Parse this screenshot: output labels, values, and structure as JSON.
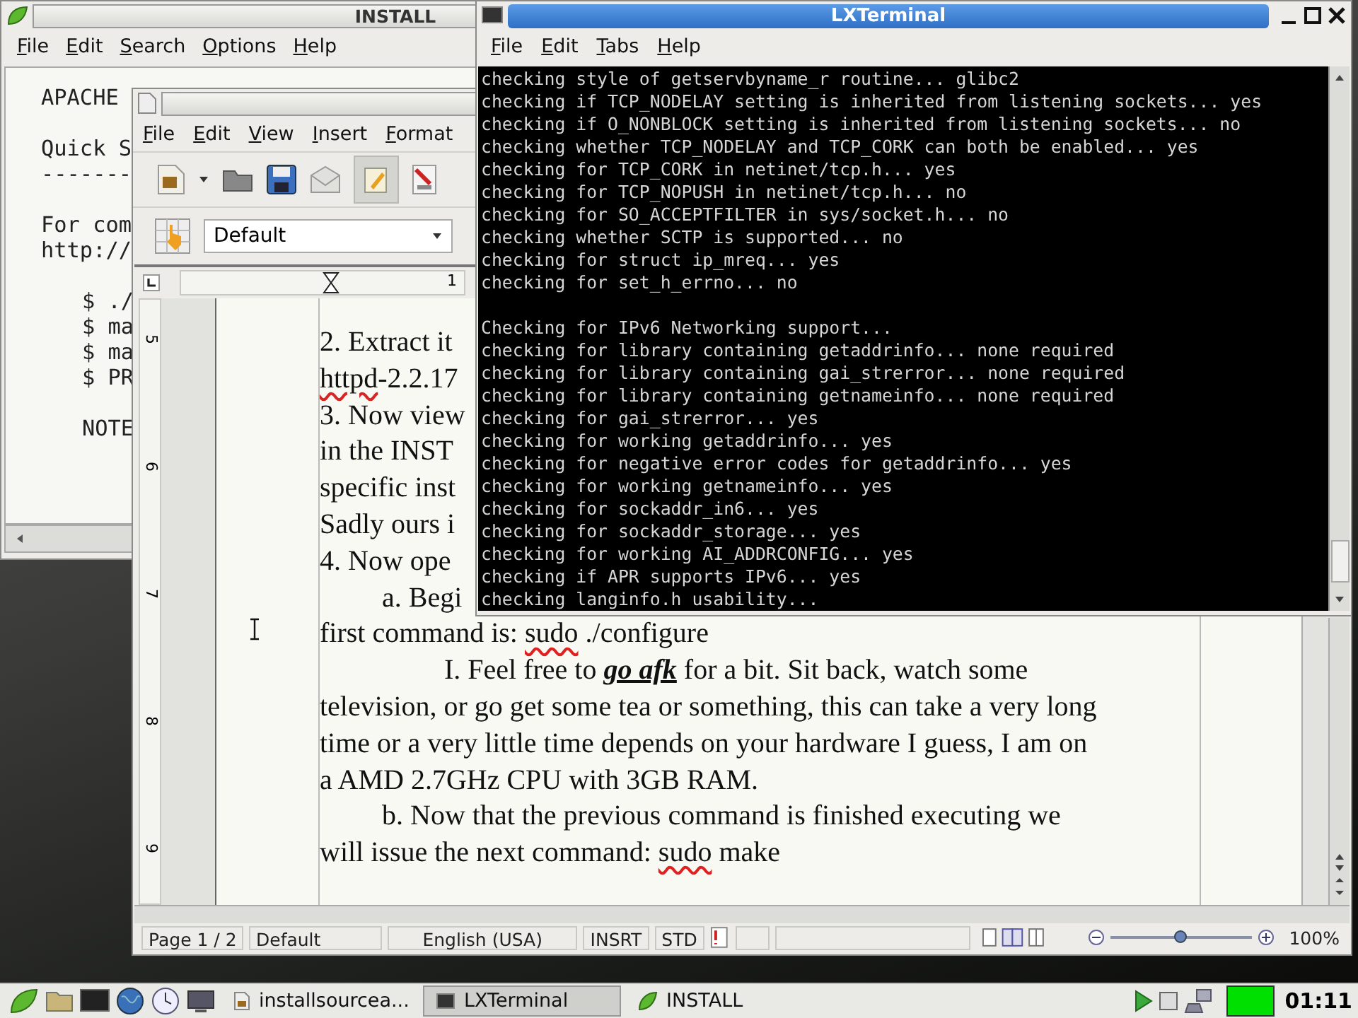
{
  "install_window": {
    "title": "INSTALL",
    "menu": [
      "File",
      "Edit",
      "Search",
      "Options",
      "Help"
    ],
    "blocks": [
      {
        "indented": false,
        "lines": [
          "APACHE"
        ]
      },
      {
        "indented": false,
        "lines": [
          "Quick S",
          "-------"
        ]
      },
      {
        "indented": false,
        "lines": [
          "For com",
          "http://"
        ]
      },
      {
        "indented": true,
        "lines": [
          "$ ./",
          "$ ma",
          "$ ma",
          "$ PR"
        ]
      },
      {
        "indented": true,
        "lines": [
          "NOTE"
        ]
      }
    ]
  },
  "writer_window": {
    "menu": [
      "File",
      "Edit",
      "View",
      "Insert",
      "Format"
    ],
    "paragraph_style": "Default",
    "horizontal_ruler_marks": [
      "1"
    ],
    "vertical_ruler_marks": [
      "5",
      "6",
      "7",
      "8",
      "9"
    ],
    "lines": [
      {
        "kind": "body",
        "parts": [
          {
            "text": "2. Extract it",
            "kind": "plain"
          }
        ]
      },
      {
        "kind": "body",
        "parts": [
          {
            "text": "httpd",
            "kind": "misspelled"
          },
          {
            "text": "-2.2.17",
            "kind": "plain"
          }
        ]
      },
      {
        "kind": "body",
        "parts": [
          {
            "text": "3. Now view",
            "kind": "plain"
          }
        ]
      },
      {
        "kind": "body",
        "parts": [
          {
            "text": "in the INST",
            "kind": "plain"
          }
        ]
      },
      {
        "kind": "body",
        "parts": [
          {
            "text": "specific inst",
            "kind": "plain"
          }
        ]
      },
      {
        "kind": "body",
        "parts": [
          {
            "text": "Sadly ours i",
            "kind": "plain"
          }
        ]
      },
      {
        "kind": "body",
        "parts": [
          {
            "text": "4. Now ope",
            "kind": "plain"
          }
        ]
      },
      {
        "kind": "sub",
        "parts": [
          {
            "text": "a. Begi",
            "kind": "plain"
          }
        ]
      },
      {
        "kind": "body",
        "parts": [
          {
            "text": "first command is: ",
            "kind": "plain"
          },
          {
            "text": "sudo",
            "kind": "misspelled"
          },
          {
            "text": " ./configure",
            "kind": "plain"
          }
        ]
      },
      {
        "kind": "subsub",
        "parts": [
          {
            "text": "I. Feel free to ",
            "kind": "plain"
          },
          {
            "text": "go afk",
            "kind": "emphasis"
          },
          {
            "text": " for a bit. Sit back, watch some",
            "kind": "plain"
          }
        ]
      },
      {
        "kind": "body",
        "parts": [
          {
            "text": "television, or go get some tea or something, this can take a very long",
            "kind": "plain"
          }
        ]
      },
      {
        "kind": "body",
        "parts": [
          {
            "text": "time or a very little time depends on your hardware I guess, I am on",
            "kind": "plain"
          }
        ]
      },
      {
        "kind": "body",
        "parts": [
          {
            "text": "a AMD 2.7GHz CPU with 3GB RAM.",
            "kind": "plain"
          }
        ]
      },
      {
        "kind": "sub",
        "parts": [
          {
            "text": "b. Now that the previous command is finished executing we",
            "kind": "plain"
          }
        ]
      },
      {
        "kind": "body",
        "parts": [
          {
            "text": "will issue the next command: ",
            "kind": "plain"
          },
          {
            "text": "sudo",
            "kind": "misspelled"
          },
          {
            "text": " make",
            "kind": "plain"
          }
        ]
      }
    ],
    "status_bar": {
      "page": "Page 1 / 2",
      "page_style": "Default",
      "language": "English (USA)",
      "insert_mode": "INSRT",
      "selection_mode": "STD",
      "zoom": {
        "level": 0.5
      },
      "zoom_reading": "100%"
    }
  },
  "terminal_window": {
    "title": "LXTerminal",
    "menu": [
      "File",
      "Edit",
      "Tabs",
      "Help"
    ],
    "blocks": [
      [
        "checking style of getservbyname_r routine... glibc2",
        "checking if TCP_NODELAY setting is inherited from listening sockets... yes",
        "checking if O_NONBLOCK setting is inherited from listening sockets... no",
        "checking whether TCP_NODELAY and TCP_CORK can both be enabled... yes",
        "checking for TCP_CORK in netinet/tcp.h... yes",
        "checking for TCP_NOPUSH in netinet/tcp.h... no",
        "checking for SO_ACCEPTFILTER in sys/socket.h... no",
        "checking whether SCTP is supported... no",
        "checking for struct ip_mreq... yes",
        "checking for set_h_errno... no"
      ],
      [
        "Checking for IPv6 Networking support...",
        "checking for library containing getaddrinfo... none required",
        "checking for library containing gai_strerror... none required",
        "checking for library containing getnameinfo... none required",
        "checking for gai_strerror... yes",
        "checking for working getaddrinfo... yes",
        "checking for negative error codes for getaddrinfo... yes",
        "checking for working getnameinfo... yes",
        "checking for sockaddr_in6... yes",
        "checking for sockaddr_storage... yes",
        "checking for working AI_ADDRCONFIG... yes",
        "checking if APR supports IPv6... yes",
        "checking langinfo.h usability..."
      ]
    ]
  },
  "taskbar": {
    "tasks": [
      {
        "label": "installsourcea...",
        "kind": "document",
        "selected": false
      },
      {
        "label": "LXTerminal",
        "kind": "terminal",
        "selected": true
      },
      {
        "label": "INSTALL",
        "kind": "editor",
        "selected": false
      }
    ],
    "clock": "01:11"
  }
}
